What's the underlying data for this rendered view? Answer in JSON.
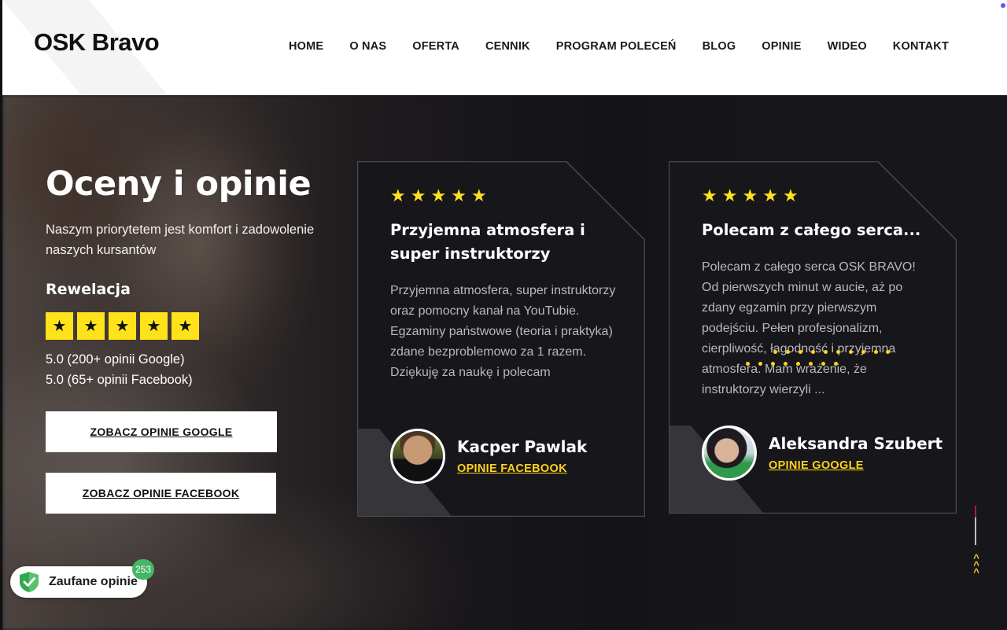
{
  "header": {
    "logo_bold": "OSK",
    "logo_rest": " Bravo",
    "nav": [
      "HOME",
      "O NAS",
      "OFERTA",
      "CENNIK",
      "PROGRAM POLECEŃ",
      "BLOG",
      "OPINIE",
      "WIDEO",
      "KONTAKT"
    ]
  },
  "hero": {
    "title": "Oceny i opinie",
    "subtitle": "Naszym priorytetem jest komfort i zadowolenie naszych kursantów",
    "rating_label": "Rewelacja",
    "rating_stars": 5,
    "rating_google": "5.0 (200+ opinii Google)",
    "rating_facebook": "5.0 (65+ opinii Facebook)",
    "button_google": "ZOBACZ OPINIE GOOGLE",
    "button_facebook": "ZOBACZ OPINIE FACEBOOK"
  },
  "reviews": [
    {
      "stars": 5,
      "title": "Przyjemna atmosfera i super instruktorzy",
      "text": "Przyjemna atmosfera, super instruktorzy oraz pomocny kanał na YouTubie. Egzaminy państwowe (teoria i praktyka) zdane bezproblemowo za 1 razem. Dziękuję za naukę i polecam",
      "name": "Kacper Pawlak",
      "source": "OPINIE FACEBOOK"
    },
    {
      "stars": 5,
      "title": "Polecam z całego serca...",
      "text": "Polecam z całego serca OSK BRAVO! Od pierwszych minut w aucie, aż po zdany egzamin przy pierwszym podejściu. Pełen profesjonalizm, cierpliwość, łagodność i przyjemna atmosfera. Mam wrażenie, że instruktorzy wierzyli ...",
      "name": "Aleksandra Szubert",
      "source": "OPINIE GOOGLE"
    }
  ],
  "trust_badge": {
    "label": "Zaufane opinie",
    "count": "253"
  },
  "colors": {
    "accent_yellow": "#ffe21a",
    "hero_bg": "#17161a",
    "badge_green": "#46b565"
  },
  "icons": {
    "star": "star-icon",
    "trust": "shield-check-icon",
    "scroll_top": "chevrons-up-icon"
  }
}
